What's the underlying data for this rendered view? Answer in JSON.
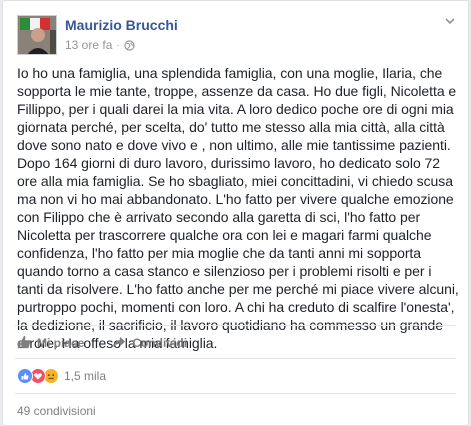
{
  "post": {
    "author": "Maurizio Brucchi",
    "time": "13 ore fa",
    "separator": "·",
    "privacy_icon": "globe-icon",
    "menu_icon": "chevron-down-icon",
    "text": "Io ho una famiglia, una splendida famiglia, con una moglie, Ilaria, che sopporta le mie tante, troppe, assenze da casa. Ho due figli, Nicoletta e Fillippo, per i quali darei la mia vita. A loro dedico poche ore di ogni mia giornata perché, per scelta, do' tutto me stesso alla mia città, alla città dove sono nato e dove vivo e , non ultimo, alle mie tantissime pazienti. Dopo 164 giorni di duro lavoro, durissimo lavoro, ho dedicato solo 72 ore alla mia famiglia. Se ho sbagliato, miei concittadini, vi chiedo scusa ma non vi ho mai abbandonato. L'ho fatto per vivere qualche emozione con Filippo che è arrivato secondo alla garetta di sci, l'ho fatto per Nicoletta per trascorrere qualche ora con lei e magari farmi qualche confidenza, l'ho fatto per mia moglie che da tanti anni mi sopporta quando torno a casa stanco e silenzioso per i problemi risolti e per i tanti da risolvere. L'ho fatto anche per me perché mi piace vivere alcuni, purtroppo pochi, momenti con loro. A chi ha creduto di scalfire l'onesta', la dedizione, il sacrificio, il lavoro quotidiano ha commesso un grande errore. Ha offeso la mia famiglia."
  },
  "actions": {
    "like_label": "Mi piace",
    "like_icon": "thumbs-up-icon",
    "share_label": "Condividi",
    "share_icon": "share-arrow-icon"
  },
  "reactions": {
    "icons": [
      "like-reaction-icon",
      "love-reaction-icon",
      "sad-reaction-icon"
    ],
    "count": "1,5 mila"
  },
  "shares": {
    "label": "49 condivisioni"
  },
  "colors": {
    "author_link": "#365899",
    "muted": "#90949c",
    "like_blue": "#5890ff",
    "love_red": "#f25268",
    "sad_yellow": "#f7b125"
  }
}
